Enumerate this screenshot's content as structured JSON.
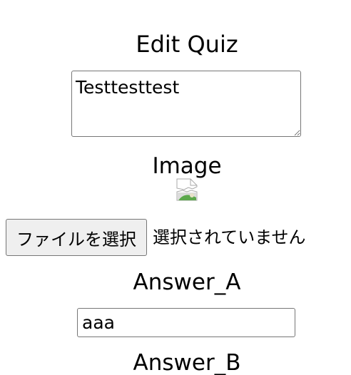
{
  "form": {
    "title": "Edit Quiz",
    "quiz_text": "Testtesttest",
    "image_label": "Image",
    "image_icon": "broken-image-icon",
    "file_button_label": "ファイルを選択",
    "file_status": "選択されていません",
    "answer_a_label": "Answer_A",
    "answer_a_value": "aaa",
    "answer_b_label": "Answer_B"
  }
}
